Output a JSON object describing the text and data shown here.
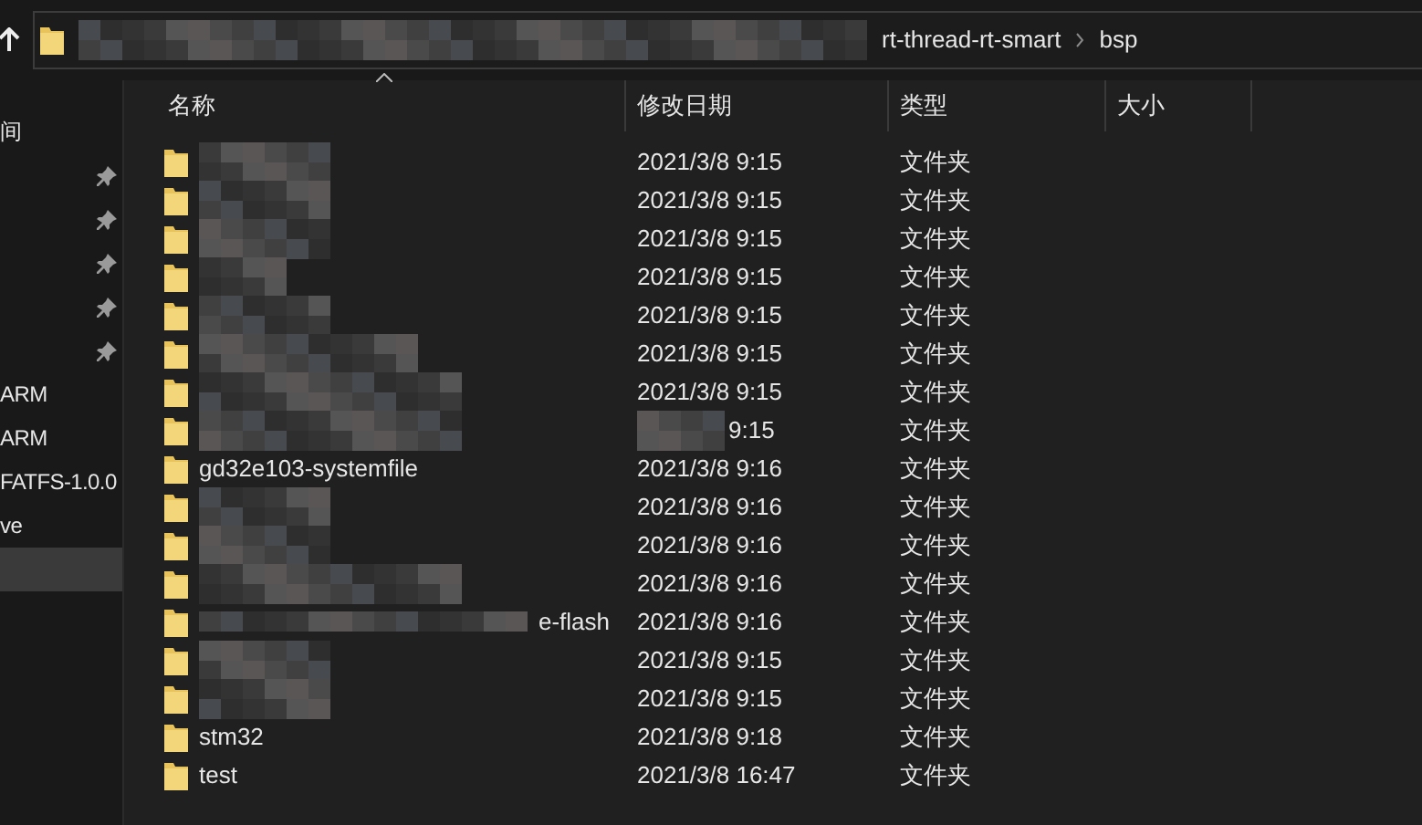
{
  "address_bar": {
    "segments": [
      "rt-thread-rt-smart",
      "bsp"
    ],
    "path_blurred": true
  },
  "nav_pane": {
    "items": [
      {
        "label": "间",
        "pinned": false,
        "selected": false
      },
      {
        "pinned": true,
        "selected": false
      },
      {
        "pinned": true,
        "selected": false
      },
      {
        "pinned": true,
        "selected": false
      },
      {
        "pinned": true,
        "selected": false
      },
      {
        "pinned": true,
        "selected": false
      },
      {
        "label": "ARM",
        "pinned": false,
        "selected": false
      },
      {
        "label": "ARM",
        "pinned": false,
        "selected": false
      },
      {
        "label": "FATFS-1.0.0",
        "pinned": false,
        "selected": false
      },
      {
        "label": "ve",
        "pinned": false,
        "selected": false
      },
      {
        "pinned": false,
        "selected": true
      }
    ]
  },
  "columns": [
    {
      "label": "名称",
      "sorted": true
    },
    {
      "label": "修改日期",
      "sorted": false
    },
    {
      "label": "类型",
      "sorted": false
    },
    {
      "label": "大小",
      "sorted": false
    }
  ],
  "rows": [
    {
      "kind": "blurred",
      "date": "2021/3/8 9:15",
      "date_blurred": false,
      "type": "文件夹"
    },
    {
      "kind": "blurred",
      "date": "2021/3/8 9:15",
      "date_blurred": false,
      "type": "文件夹"
    },
    {
      "kind": "blurred",
      "date": "2021/3/8 9:15",
      "date_blurred": false,
      "type": "文件夹"
    },
    {
      "kind": "blurred",
      "date": "2021/3/8 9:15",
      "date_blurred": false,
      "type": "文件夹"
    },
    {
      "kind": "blurred",
      "date": "2021/3/8 9:15",
      "date_blurred": false,
      "type": "文件夹"
    },
    {
      "kind": "blurred",
      "date": "2021/3/8 9:15",
      "date_blurred": false,
      "type": "文件夹"
    },
    {
      "kind": "blurred",
      "date": "2021/3/8 9:15",
      "date_blurred": false,
      "type": "文件夹"
    },
    {
      "kind": "blurred",
      "date": "9:15",
      "date_blurred": true,
      "type": "文件夹"
    },
    {
      "kind": "plain",
      "name": "gd32e103-systemfile",
      "date": "2021/3/8 9:16",
      "date_blurred": false,
      "type": "文件夹"
    },
    {
      "kind": "blurred",
      "date": "2021/3/8 9:16",
      "date_blurred": false,
      "type": "文件夹"
    },
    {
      "kind": "blurred",
      "date": "2021/3/8 9:16",
      "date_blurred": false,
      "type": "文件夹"
    },
    {
      "kind": "blurred",
      "date": "2021/3/8 9:16",
      "date_blurred": false,
      "type": "文件夹"
    },
    {
      "kind": "partly_blurred",
      "name": "e-flash",
      "date": "2021/3/8 9:16",
      "date_blurred": false,
      "type": "文件夹"
    },
    {
      "kind": "blurred",
      "date": "2021/3/8 9:15",
      "date_blurred": false,
      "type": "文件夹"
    },
    {
      "kind": "blurred",
      "date": "2021/3/8 9:15",
      "date_blurred": false,
      "type": "文件夹"
    },
    {
      "kind": "plain",
      "name": "stm32",
      "date": "2021/3/8 9:18",
      "date_blurred": false,
      "type": "文件夹"
    },
    {
      "kind": "plain",
      "name": "test",
      "date": "2021/3/8 16:47",
      "date_blurred": false,
      "type": "文件夹"
    }
  ]
}
